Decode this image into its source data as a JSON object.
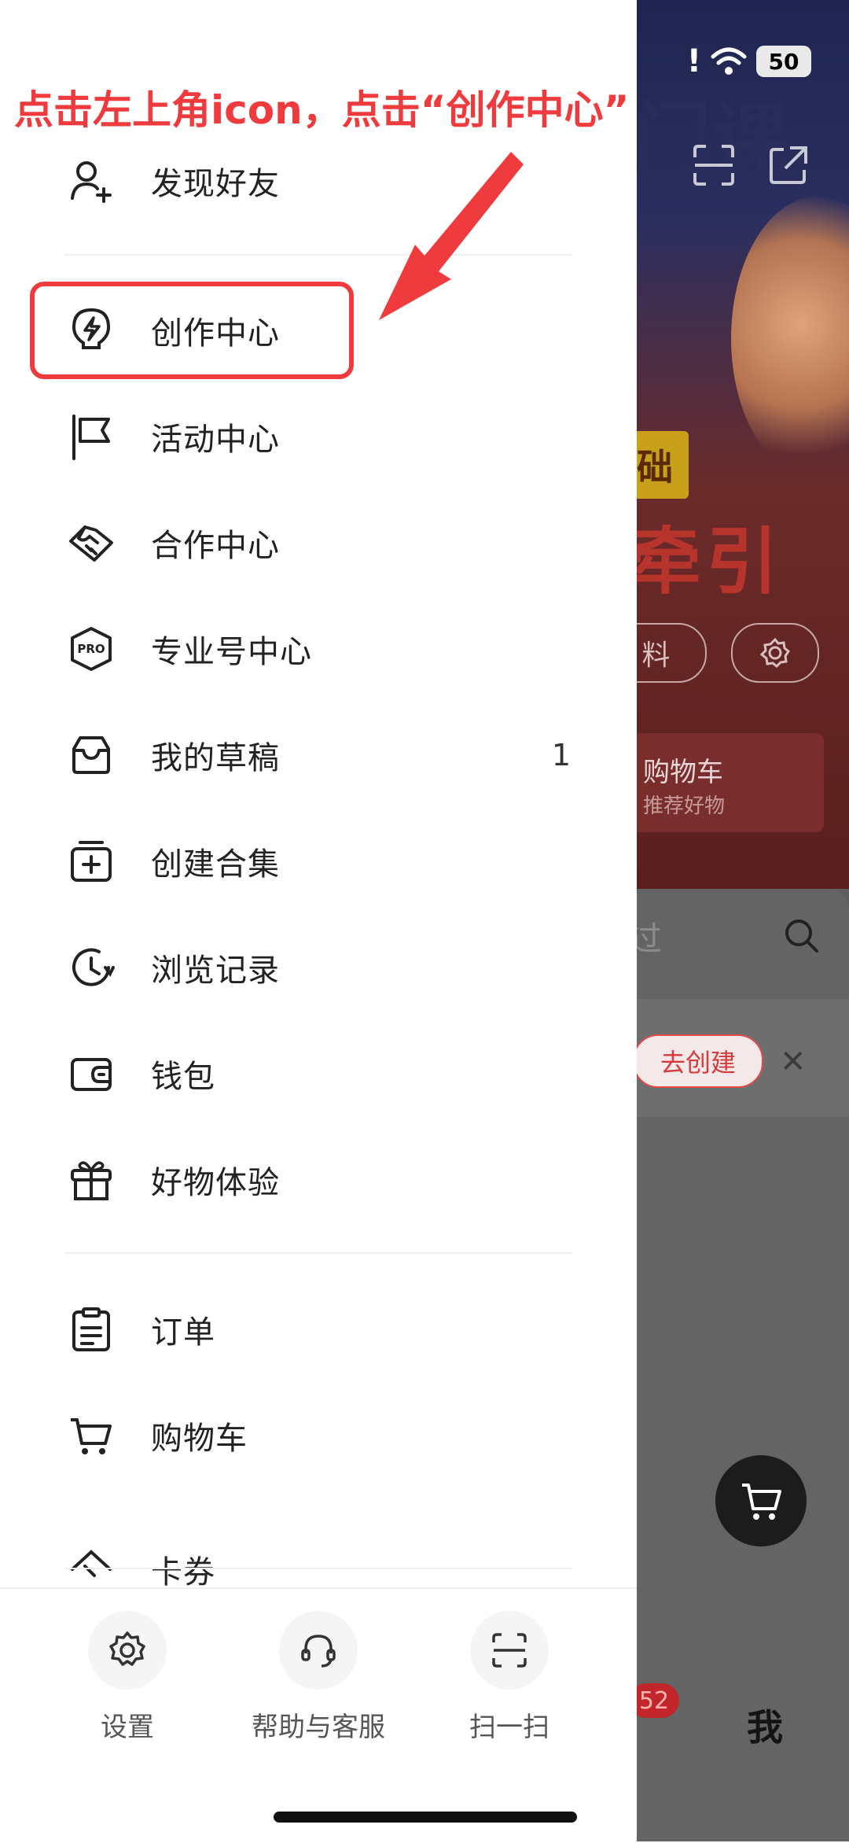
{
  "annotation": {
    "text": "点击左上角icon，点击“创作中心”",
    "color": "#ef3b3d"
  },
  "drawer": {
    "items_group1": [
      {
        "label": "发现好友",
        "icon": "add-friend-icon"
      }
    ],
    "items_group2": [
      {
        "label": "创作中心",
        "icon": "bolt-bulb-icon"
      },
      {
        "label": "活动中心",
        "icon": "flag-icon"
      },
      {
        "label": "合作中心",
        "icon": "handshake-icon"
      },
      {
        "label": "专业号中心",
        "icon": "pro-badge-icon",
        "icon_text": "PRO"
      },
      {
        "label": "我的草稿",
        "icon": "inbox-icon",
        "count": "1"
      },
      {
        "label": "创建合集",
        "icon": "add-collection-icon"
      },
      {
        "label": "浏览记录",
        "icon": "history-clock-icon"
      },
      {
        "label": "钱包",
        "icon": "wallet-icon"
      },
      {
        "label": "好物体验",
        "icon": "gift-icon"
      }
    ],
    "items_group3": [
      {
        "label": "订单",
        "icon": "order-clipboard-icon"
      },
      {
        "label": "购物车",
        "icon": "cart-icon"
      },
      {
        "label": "卡券",
        "icon": "coupon-icon"
      }
    ],
    "quick_actions": [
      {
        "label": "设置",
        "icon": "gear-icon"
      },
      {
        "label": "帮助与客服",
        "icon": "headset-icon"
      },
      {
        "label": "扫一扫",
        "icon": "scan-icon"
      }
    ]
  },
  "background": {
    "battery": "50",
    "banner_text": "门课",
    "tag": "础",
    "big_text": "牵引",
    "pill_text": "料",
    "card_title": "购物车",
    "card_subtitle": "推荐好物",
    "search_hint": "过",
    "create_button": "去创建",
    "badge": "52",
    "me_tab": "我"
  }
}
